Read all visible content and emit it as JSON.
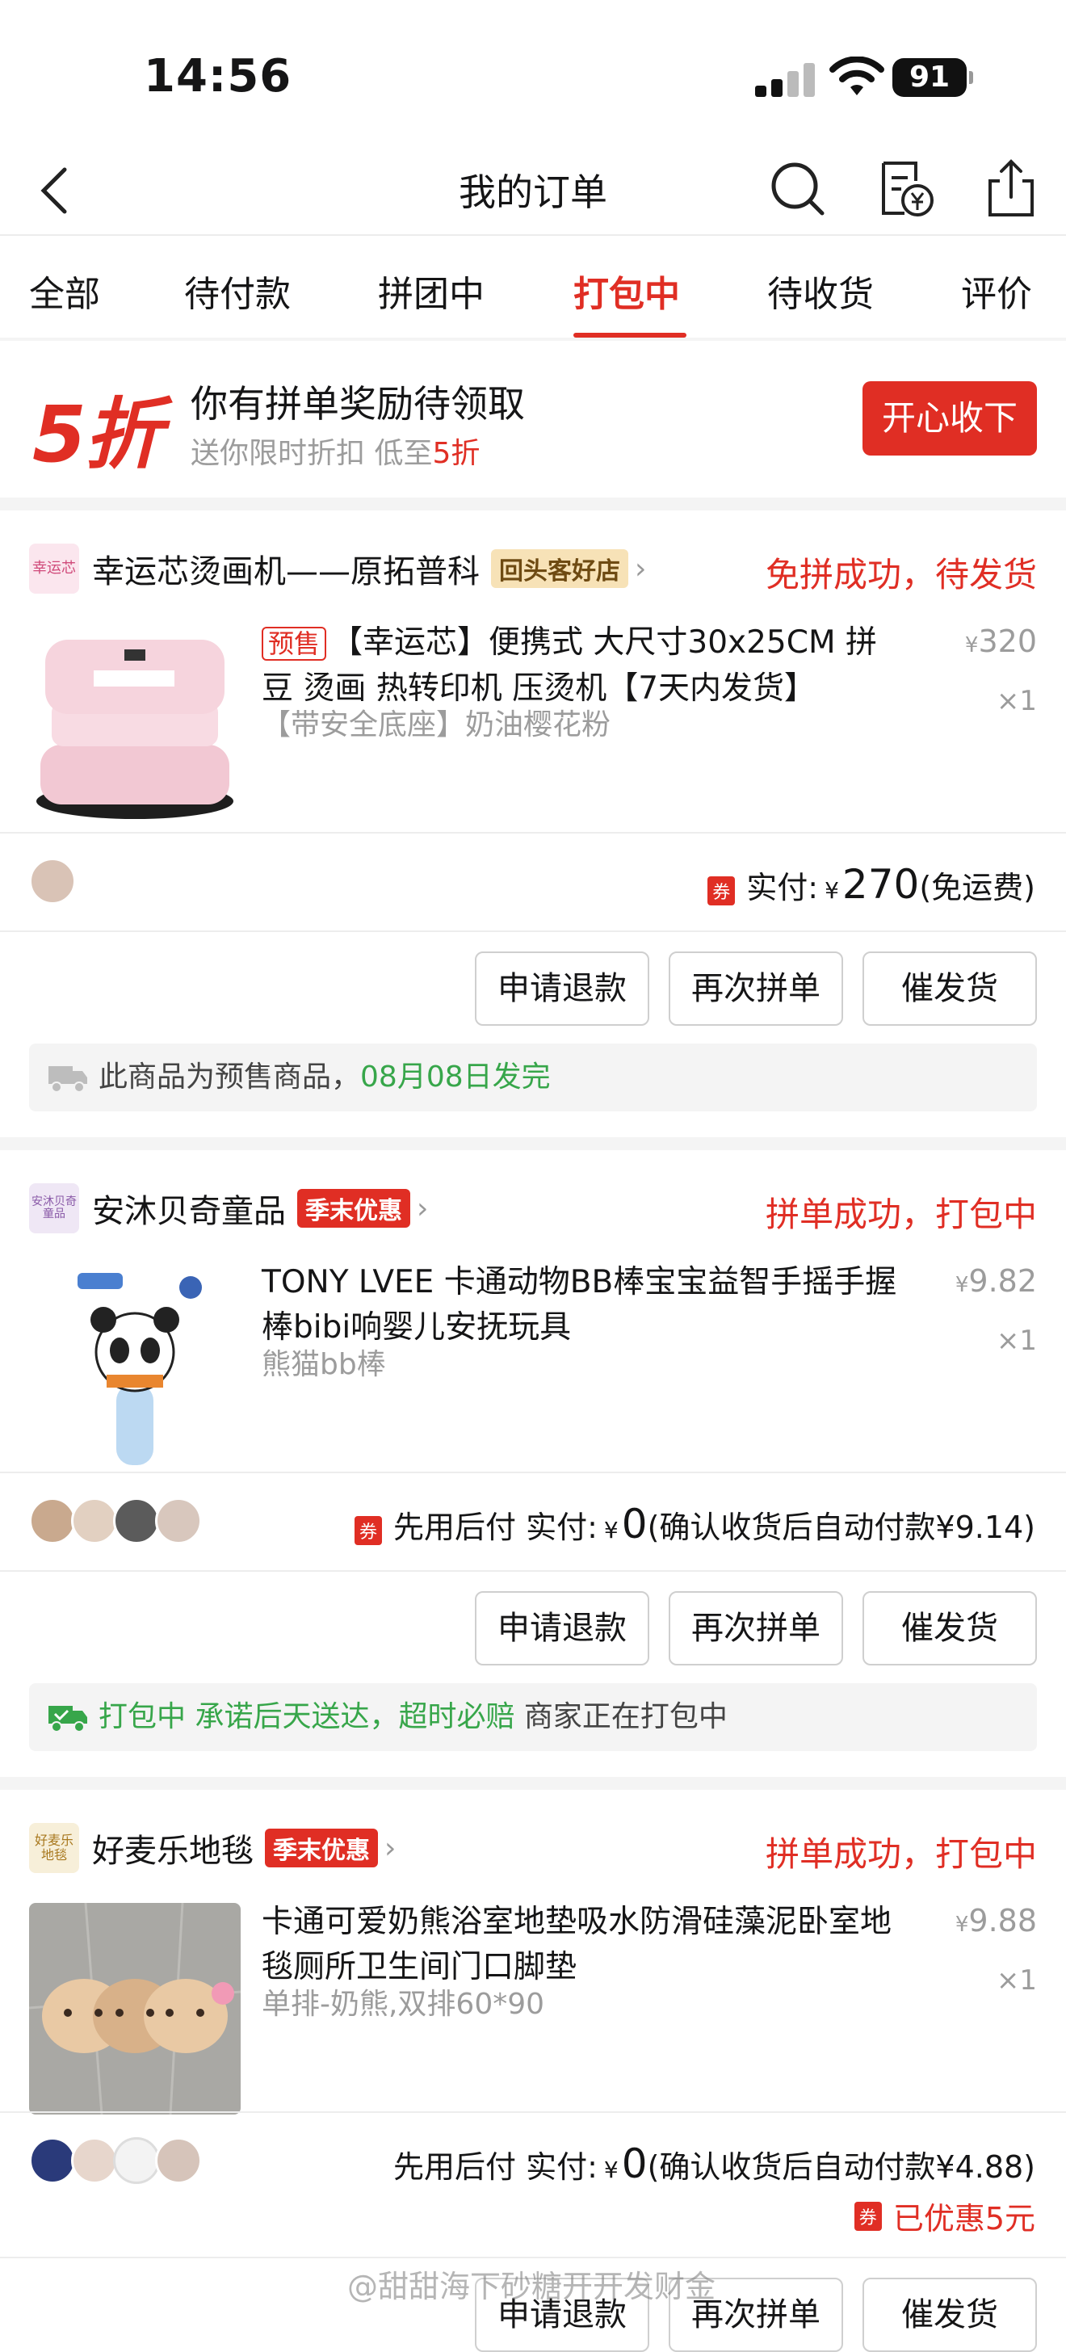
{
  "status_bar": {
    "time": "14:56",
    "battery": "91"
  },
  "nav": {
    "title": "我的订单"
  },
  "tabs": [
    {
      "label": "全部"
    },
    {
      "label": "待付款"
    },
    {
      "label": "拼团中"
    },
    {
      "label": "打包中"
    },
    {
      "label": "待收货"
    },
    {
      "label": "评价"
    }
  ],
  "active_tab": "打包中",
  "promo": {
    "badge": "5折",
    "heading": "你有拼单奖励待领取",
    "sub_prefix": "送你限时折扣 低至",
    "sub_highlight": "5折",
    "button": "开心收下"
  },
  "orders": [
    {
      "shop_logo_text": "幸运芯",
      "shop_name": "幸运芯烫画机——原拓普科",
      "shop_tag": "回头客好店",
      "status": "免拼成功，待发货",
      "presale_badge": "预售",
      "title": "【幸运芯】便携式 大尺寸30x25CM 拼豆 烫画 热转印机 压烫机【7天内发货】",
      "spec": "【带安全底座】奶油樱花粉",
      "price": "320",
      "qty": "×1",
      "pay_label": "实付:",
      "pay_amount": "270",
      "pay_suffix": "(免运费)",
      "coupon": "券",
      "buttons": [
        "申请退款",
        "再次拼单",
        "催发货"
      ],
      "notice_text": "此商品为预售商品，",
      "notice_highlight": "08月08日发完"
    },
    {
      "shop_logo_text": "安沐贝奇童品",
      "shop_name": "安沐贝奇童品",
      "shop_tag": "季末优惠",
      "status": "拼单成功，打包中",
      "title": "TONY LVEE 卡通动物BB棒宝宝益智手摇手握棒bibi响婴儿安抚玩具",
      "spec": "熊猫bb棒",
      "price": "9.82",
      "qty": "×1",
      "pay_prefix": "先用后付",
      "pay_label": "实付:",
      "pay_amount": "0",
      "pay_suffix": "(确认收货后自动付款¥9.14)",
      "coupon": "券",
      "buttons": [
        "申请退款",
        "再次拼单",
        "催发货"
      ],
      "notice_highlight": "打包中 承诺后天送达，超时必赔",
      "notice_text": " 商家正在打包中"
    },
    {
      "shop_logo_text": "好麦乐地毯",
      "shop_name": "好麦乐地毯",
      "shop_tag": "季末优惠",
      "status": "拼单成功，打包中",
      "title": "卡通可爱奶熊浴室地垫吸水防滑硅藻泥卧室地毯厕所卫生间门口脚垫",
      "spec": "单排-奶熊,双排60*90",
      "price": "9.88",
      "qty": "×1",
      "pay_prefix": "先用后付",
      "pay_label": "实付:",
      "pay_amount": "0",
      "pay_suffix": "(确认收货后自动付款¥4.88)",
      "coupon": "券",
      "saved": "已优惠5元",
      "buttons": [
        "申请退款",
        "再次拼单",
        "催发货"
      ]
    }
  ],
  "currency": "¥",
  "watermark": "@甜甜海下砂糖开开发财金",
  "colors": {
    "accent": "#e02e24",
    "green": "#37a64a",
    "gold_tag": "#f7e2b7"
  }
}
